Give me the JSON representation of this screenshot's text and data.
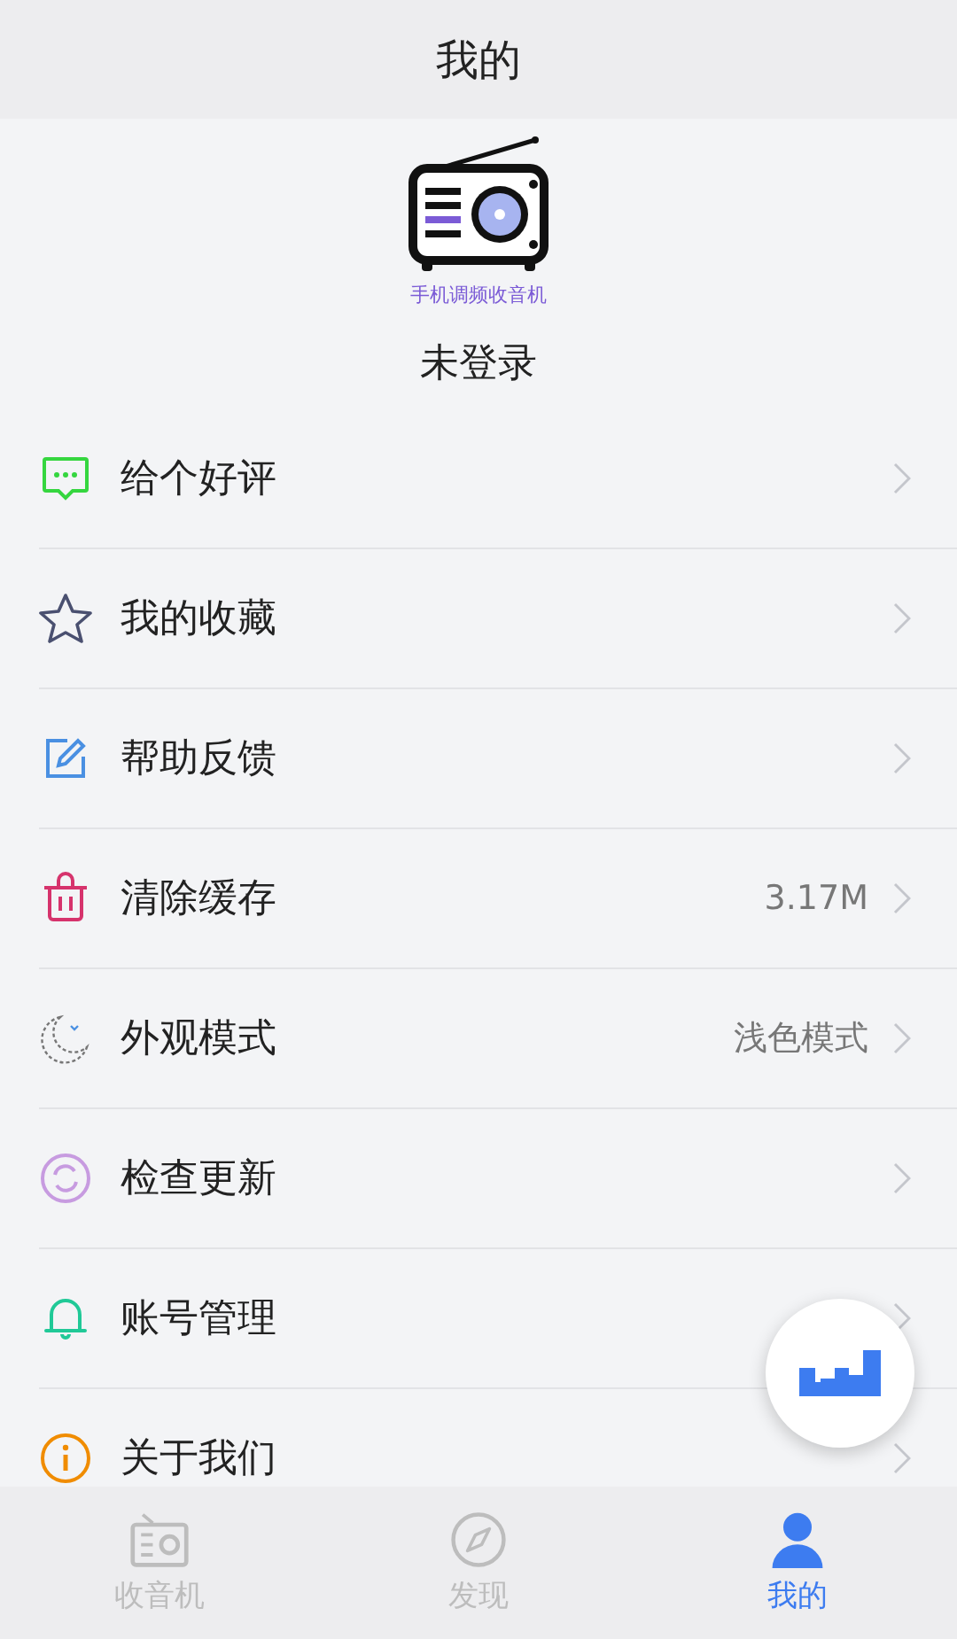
{
  "header": {
    "title": "我的"
  },
  "profile": {
    "app_caption": "手机调频收音机",
    "login_status": "未登录"
  },
  "menu": [
    {
      "kind": "review",
      "label": "给个好评"
    },
    {
      "kind": "favorites",
      "label": "我的收藏"
    },
    {
      "kind": "feedback",
      "label": "帮助反馈"
    },
    {
      "kind": "cache",
      "label": "清除缓存",
      "value": "3.17M"
    },
    {
      "kind": "theme",
      "label": "外观模式",
      "value": "浅色模式"
    },
    {
      "kind": "update",
      "label": "检查更新"
    },
    {
      "kind": "account",
      "label": "账号管理"
    },
    {
      "kind": "about",
      "label": "关于我们"
    }
  ],
  "tabs": [
    {
      "kind": "radio",
      "label": "收音机",
      "selected": false
    },
    {
      "kind": "discover",
      "label": "发现",
      "selected": false
    },
    {
      "kind": "me",
      "label": "我的",
      "selected": true
    }
  ]
}
